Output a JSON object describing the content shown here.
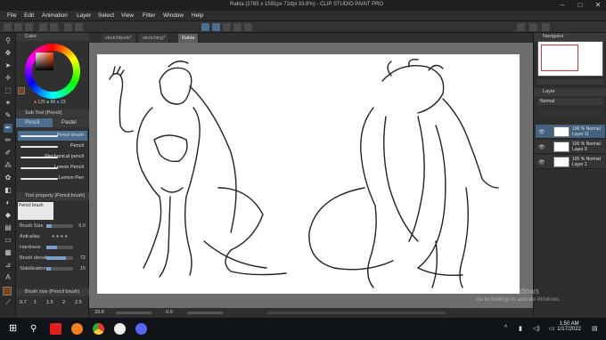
{
  "window": {
    "title": "Rakta (2785 x 1591px 72dpi 33.8%) - CLIP STUDIO PAINT PRO"
  },
  "menu": [
    "File",
    "Edit",
    "Animation",
    "Layer",
    "Select",
    "View",
    "Filter",
    "Window",
    "Help"
  ],
  "tabs": [
    {
      "label": "sketchbook*",
      "active": false
    },
    {
      "label": "sketching*",
      "active": false
    },
    {
      "label": "Rakta",
      "active": true
    }
  ],
  "color_panel": {
    "tab_label": "Color",
    "r": "125",
    "g": "66",
    "b": "23",
    "main_color": "#7d4217"
  },
  "sub_tool": {
    "header": "Sub Tool (Pencil)",
    "tabs": [
      "Pencil",
      "Pastel"
    ],
    "brushes": [
      "Pencil brush",
      "Pencil",
      "Mechanical pencil",
      "Lemon Pencil",
      "Lemon Pen"
    ],
    "selected_index": 0
  },
  "tool_property": {
    "header": "Tool property (Pencil brush)",
    "brush_name": "Pencil brush",
    "rows": [
      {
        "label": "Brush Size",
        "value": "6.0",
        "fill": 0.2
      },
      {
        "label": "Anti-alias",
        "value": "",
        "fill": 0.6
      },
      {
        "label": "Hardness",
        "value": "",
        "fill": 0.4
      },
      {
        "label": "Brush density",
        "value": "72",
        "fill": 0.72
      },
      {
        "label": "Stabilization",
        "value": "15",
        "fill": 0.15
      }
    ]
  },
  "brush_size_panel": {
    "header": "Brush size (Pencil brush)",
    "sizes": [
      "0.7",
      "1",
      "1.5",
      "2",
      "2.5"
    ]
  },
  "status": {
    "zoom": "33.8",
    "rotation": "0.0"
  },
  "navigator": {
    "header": "Navigator"
  },
  "layers": {
    "header": "Layer",
    "blend": "Normal",
    "items": [
      {
        "opacity": "100 %",
        "mode": "Normal",
        "name": "Layer 11",
        "selected": true
      },
      {
        "opacity": "100 %",
        "mode": "Normal",
        "name": "Layer 9",
        "selected": false
      },
      {
        "opacity": "100 %",
        "mode": "Normal",
        "name": "Layer 1",
        "selected": false
      }
    ]
  },
  "watermark": {
    "line1": "Activate Windows",
    "line2": "Go to Settings to activate Windows."
  },
  "taskbar": {
    "time": "1:50 AM",
    "date": "1/17/2022",
    "apps": [
      "start-icon",
      "search-icon",
      "taskview-icon",
      "youtube-icon",
      "firefox-icon",
      "chrome-icon",
      "clipstudio-icon",
      "discord-icon"
    ]
  }
}
